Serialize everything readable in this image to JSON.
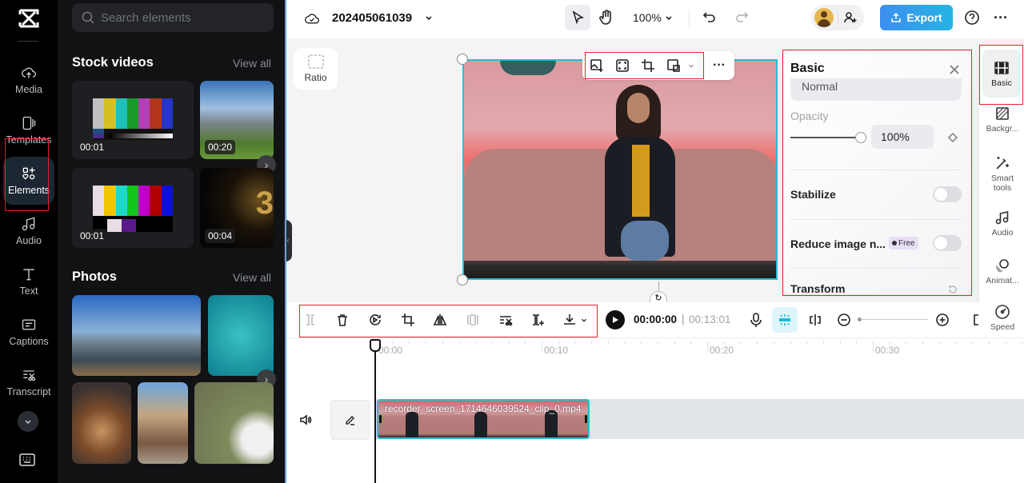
{
  "app": {
    "brand_icon": "capcut-logo-icon"
  },
  "rail": {
    "items": [
      {
        "label": "Media",
        "icon": "cloud-upload-icon"
      },
      {
        "label": "Templates",
        "icon": "templates-icon"
      },
      {
        "label": "Elements",
        "icon": "elements-icon",
        "active": true
      },
      {
        "label": "Audio",
        "icon": "music-note-icon"
      },
      {
        "label": "Text",
        "icon": "text-t-icon"
      },
      {
        "label": "Captions",
        "icon": "captions-icon"
      },
      {
        "label": "Transcript",
        "icon": "transcript-icon"
      }
    ],
    "more_icon": "chevron-down-icon",
    "keyboard_icon": "keyboard-icon"
  },
  "panel": {
    "search": {
      "placeholder": "Search elements"
    },
    "stock_videos": {
      "title": "Stock videos",
      "view_all": "View all",
      "items": [
        {
          "duration": "00:01",
          "kind": "color bars"
        },
        {
          "duration": "00:20",
          "kind": "mountain landscape"
        },
        {
          "duration": "00:01",
          "kind": "color bars"
        },
        {
          "duration": "00:04",
          "kind": "golden number 3"
        }
      ]
    },
    "photos": {
      "title": "Photos",
      "view_all": "View all",
      "items": [
        "city skyline",
        "boat on sea",
        "tacos",
        "old town street",
        "white puppy"
      ]
    }
  },
  "topbar": {
    "project_name": "202405061039",
    "zoom": "100%",
    "export_label": "Export"
  },
  "canvas": {
    "ratio_label": "Ratio"
  },
  "props": {
    "title": "Basic",
    "blend_mode": "Normal",
    "opacity_label": "Opacity",
    "opacity_value": "100%",
    "opacity_percent": 100,
    "stabilize_label": "Stabilize",
    "stabilize_on": false,
    "reduce_noise_label": "Reduce image n...",
    "reduce_noise_badge": "Free",
    "reduce_noise_on": false,
    "transform_label": "Transform"
  },
  "right_tabs": [
    {
      "label": "Basic",
      "icon": "film-icon",
      "active": true
    },
    {
      "label": "Backgr...",
      "icon": "background-icon"
    },
    {
      "label": "Smart tools",
      "icon": "magic-wand-icon"
    },
    {
      "label": "Audio",
      "icon": "music-note-icon"
    },
    {
      "label": "Animat...",
      "icon": "animation-icon"
    },
    {
      "label": "Speed",
      "icon": "speed-gauge-icon"
    }
  ],
  "timeline": {
    "current_time": "00:00:00",
    "total_time": "00:13:01",
    "ruler": [
      "00:00",
      "00:10",
      "00:20",
      "00:30"
    ],
    "clip_name": "recorder_screen_1714646039524_clip_0.mp4"
  }
}
